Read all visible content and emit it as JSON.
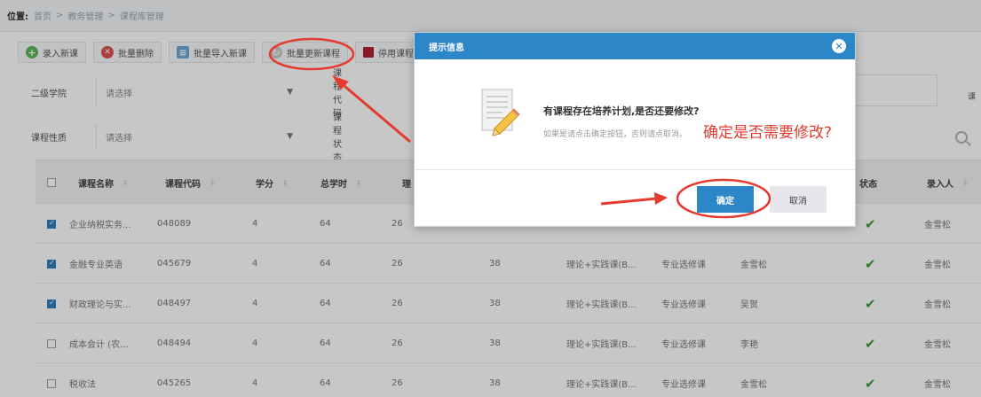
{
  "breadcrumb": {
    "label": "位置:",
    "items": [
      "首页",
      "教务管理",
      "课程库管理"
    ],
    "sep": ">"
  },
  "toolbar": {
    "add_label": "录入新课",
    "batch_delete_label": "批量删除",
    "batch_import_label": "批量导入新课",
    "batch_update_label": "批量更新课程",
    "disable_label": "停用课程"
  },
  "filters": {
    "college_label": "二级学院",
    "college_value": "请选择",
    "code_label": "课程代码",
    "nature_label": "课程性质",
    "nature_value": "请选择",
    "status_label": "课程状态",
    "right_label": "课"
  },
  "table": {
    "headers": {
      "name": "课程名称",
      "code": "课程代码",
      "credit": "学分",
      "hours": "总学时",
      "theory": "理",
      "status": "状态",
      "entered_by": "录入人"
    },
    "rows": [
      {
        "checked": true,
        "name": "企业纳税实务...",
        "code": "048089",
        "credit": "4",
        "hours": "64",
        "theory": "26",
        "practice": "",
        "type": "",
        "category": "",
        "teacher": "",
        "entered_by": "金雪松"
      },
      {
        "checked": true,
        "name": "金融专业英语",
        "code": "045679",
        "credit": "4",
        "hours": "64",
        "theory": "26",
        "practice": "38",
        "type": "理论+实践课(B...",
        "category": "专业选修课",
        "teacher": "金雪松",
        "entered_by": "金雪松"
      },
      {
        "checked": true,
        "name": "财政理论与实...",
        "code": "048497",
        "credit": "4",
        "hours": "64",
        "theory": "26",
        "practice": "38",
        "type": "理论+实践课(B...",
        "category": "专业选修课",
        "teacher": "吴贺",
        "entered_by": "金雪松"
      },
      {
        "checked": false,
        "name": "成本会计 (农...",
        "code": "048494",
        "credit": "4",
        "hours": "64",
        "theory": "26",
        "practice": "38",
        "type": "理论+实践课(B...",
        "category": "专业选修课",
        "teacher": "李艳",
        "entered_by": "金雪松"
      },
      {
        "checked": false,
        "name": "税收法",
        "code": "045265",
        "credit": "4",
        "hours": "64",
        "theory": "26",
        "practice": "38",
        "type": "理论+实践课(B...",
        "category": "专业选修课",
        "teacher": "金雪松",
        "entered_by": "金雪松"
      }
    ]
  },
  "modal": {
    "title": "提示信息",
    "message": "有课程存在培养计划,是否还要修改?",
    "hint": "如果是请点击确定按钮，否则请点取消。",
    "ok_label": "确定",
    "cancel_label": "取消"
  },
  "annotation": {
    "text": "确定是否需要修改?",
    "color": "#e53a2e"
  },
  "colors": {
    "accent": "#2d86c7",
    "check": "#3b9b3b",
    "annotation_red": "#e53a2e"
  }
}
